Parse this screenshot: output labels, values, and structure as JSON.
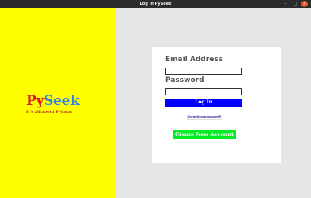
{
  "window": {
    "title": "Log In PySeek",
    "minimize_glyph": "–",
    "maximize_glyph": "□",
    "close_glyph": "✕"
  },
  "brand": {
    "py": "Py",
    "seek": "Seek",
    "tagline": "It's all about Python."
  },
  "login": {
    "email_label": "Email Address",
    "email_value": "",
    "password_label": "Password",
    "password_value": "",
    "login_button": "Log In",
    "forgot_button": "Forgotten password?",
    "create_button": "Create New Account"
  },
  "colors": {
    "left_panel": "#ffff00",
    "login_button": "#0000ff",
    "create_button": "#00ee22",
    "close_button": "#e95420"
  }
}
